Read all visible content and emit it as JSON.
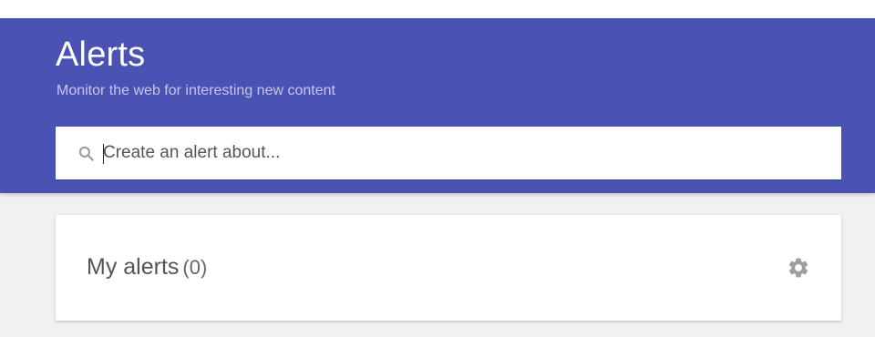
{
  "header": {
    "title": "Alerts",
    "subtitle": "Monitor the web for interesting new content",
    "background_color": "#4a52b3"
  },
  "search": {
    "placeholder": "Create an alert about...",
    "value": "",
    "icon": "search-icon"
  },
  "alerts_card": {
    "title": "My alerts",
    "count": "(0)",
    "settings_icon": "gear-icon"
  }
}
